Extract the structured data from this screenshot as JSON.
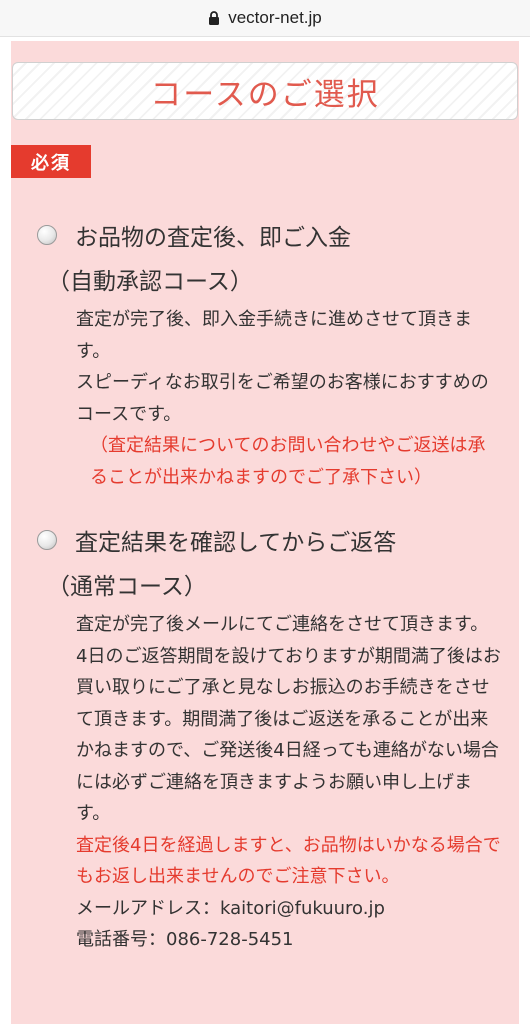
{
  "browser": {
    "url": "vector-net.jp"
  },
  "section": {
    "title": "コースのご選択",
    "required_badge": "必須"
  },
  "options": [
    {
      "label": "お品物の査定後、即ご入金",
      "sub": "（自動承認コース）",
      "lines": [
        "査定が完了後、即入金手続きに進めさせて頂きます。",
        "スピーディなお取引をご希望のお客様におすすめのコースです。"
      ],
      "note": "（査定結果についてのお問い合わせやご返送は承ることが出来かねますのでご了承下さい）"
    },
    {
      "label": "査定結果を確認してからご返答",
      "sub": "（通常コース）",
      "lines": [
        "査定が完了後メールにてご連絡をさせて頂きます。",
        "4日のご返答期間を設けておりますが期間満了後はお買い取りにご了承と見なしお振込のお手続きをさせて頂きます。期間満了後はご返送を承ることが出来かねますので、ご発送後4日経っても連絡がない場合には必ずご連絡を頂きますようお願い申し上げます。"
      ],
      "note": "査定後4日を経過しますと、お品物はいかなる場合でもお返し出来ませんのでご注意下さい。",
      "email": "メールアドレス：kaitori@fukuuro.jp",
      "phone": "電話番号：086-728-5451"
    }
  ],
  "colors": {
    "accent_red": "#e53b2e",
    "title_red": "#e15a4e",
    "panel_bg": "#fbdada"
  }
}
